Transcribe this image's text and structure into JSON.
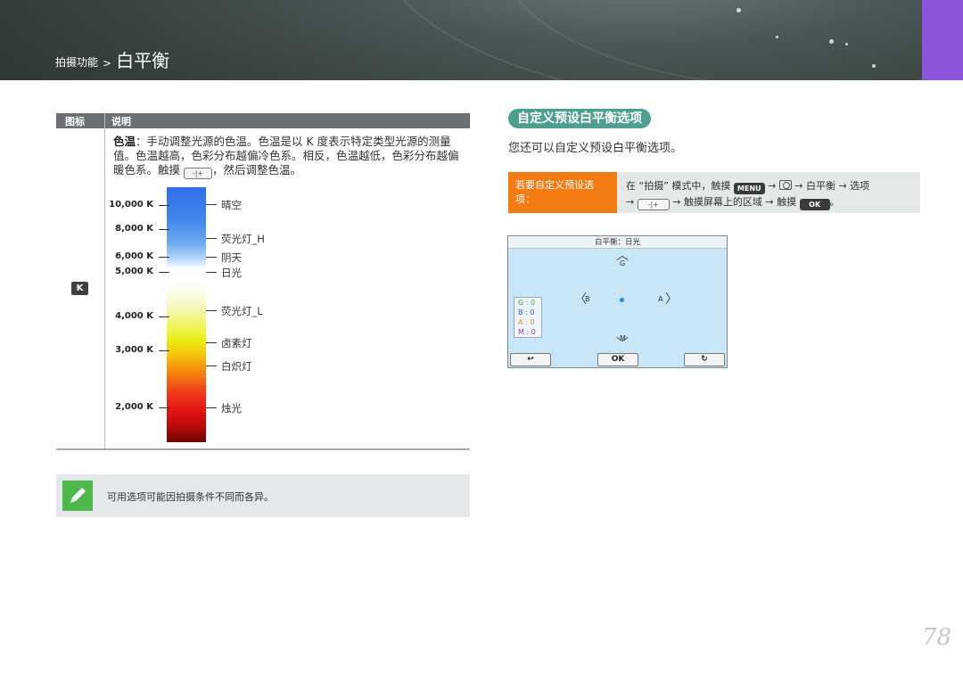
{
  "header": {
    "crumb_parent": "拍摄功能",
    "crumb_sep": ">",
    "crumb_current": "白平衡"
  },
  "table": {
    "col_icon": "图标",
    "col_desc": "说明",
    "icon_label": "K",
    "desc_bold": "色温",
    "desc_text": "：手动调整光源的色温。色温是以 K 度表示特定类型光源的测量值。色温越高，色彩分布越偏冷色系。相反，色温越低，色彩分布越偏暖色系。触摸",
    "desc_tail": "，然后调整色温。",
    "k_button_glyph": "-|+",
    "kelvin_labels": [
      "10,000 K",
      "8,000 K",
      "6,000 K",
      "5,000 K",
      "4,000 K",
      "3,000 K",
      "2,000 K"
    ],
    "source_labels": [
      "晴空",
      "荧光灯_H",
      "阴天",
      "日光",
      "荧光灯_L",
      "卤素灯",
      "白炽灯",
      "烛光"
    ]
  },
  "note": {
    "text": "可用选项可能因拍摄条件不同而各异。",
    "icon": "pencil-note-icon"
  },
  "section": {
    "title": "自定义预设白平衡选项",
    "subtitle": "您还可以自定义预设白平衡选项。"
  },
  "procedure": {
    "head": "若要自定义预设选项：",
    "line1_a": "在 “拍摄” 模式中，触摸",
    "menu_label": "MENU",
    "line1_b": "→",
    "line1_c": "→ 白平衡 → 选项",
    "line2_a": "→",
    "line2_b": "→ 触摸屏幕上的区域 → 触摸",
    "ok_label": "OK",
    "line2_end": "。",
    "k_glyph": "-|+"
  },
  "screen": {
    "title": "白平衡：日光",
    "axis_g": "G",
    "axis_m": "M",
    "axis_b": "B",
    "axis_a": "A",
    "values": [
      "G : 0",
      "B : 0",
      "A : 0",
      "M : 0"
    ],
    "btn_back": "↩",
    "btn_ok": "OK",
    "btn_reset": "↻"
  },
  "colors": {
    "accent_teal": "#4f9e92",
    "accent_orange": "#f47a12",
    "tab_purple": "#8a55d8",
    "note_green": "#4fb84c"
  },
  "page_number": "78"
}
